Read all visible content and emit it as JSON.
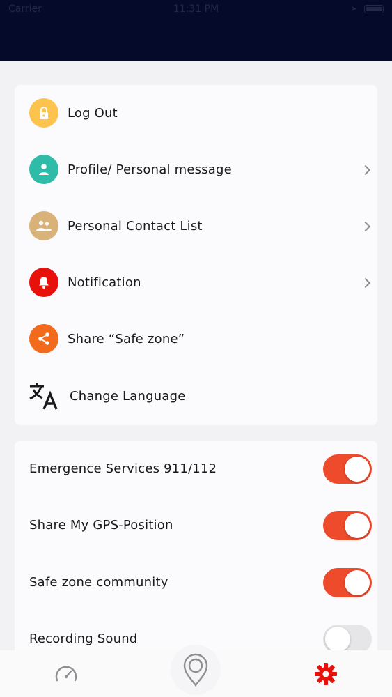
{
  "status_bar": {
    "carrier": "Carrier",
    "time": "11:31 PM"
  },
  "menu": {
    "items": [
      {
        "label": "Log Out",
        "icon": "lock-icon",
        "color": "#fcc44d",
        "chevron": false
      },
      {
        "label": "Profile/ Personal message",
        "icon": "person-icon",
        "color": "#2ebca8",
        "chevron": true
      },
      {
        "label": "Personal Contact List",
        "icon": "group-icon",
        "color": "#d9b27a",
        "chevron": true
      },
      {
        "label": "Notification",
        "icon": "bell-icon",
        "color": "#e8100b",
        "chevron": true
      },
      {
        "label": "Share “Safe zone”",
        "icon": "share-icon",
        "color": "#f26a1c",
        "chevron": false
      },
      {
        "label": "Change Language",
        "icon": "translate-icon",
        "color": "#1a1a1a",
        "chevron": false
      }
    ]
  },
  "toggles": {
    "items": [
      {
        "label": "Emergence Services 911/112",
        "on": true
      },
      {
        "label": "Share My GPS-Position",
        "on": true
      },
      {
        "label": "Safe zone community",
        "on": true
      },
      {
        "label": "Recording Sound",
        "on": false
      }
    ]
  },
  "colors": {
    "accent": "#ee4a2c",
    "header": "#050a2a",
    "settings_active": "#e8100b"
  },
  "tab_bar": {
    "tabs": [
      {
        "name": "speedometer-icon",
        "active": false
      },
      {
        "name": "location-pin-icon",
        "active": false
      },
      {
        "name": "settings-gear-icon",
        "active": true
      }
    ]
  }
}
